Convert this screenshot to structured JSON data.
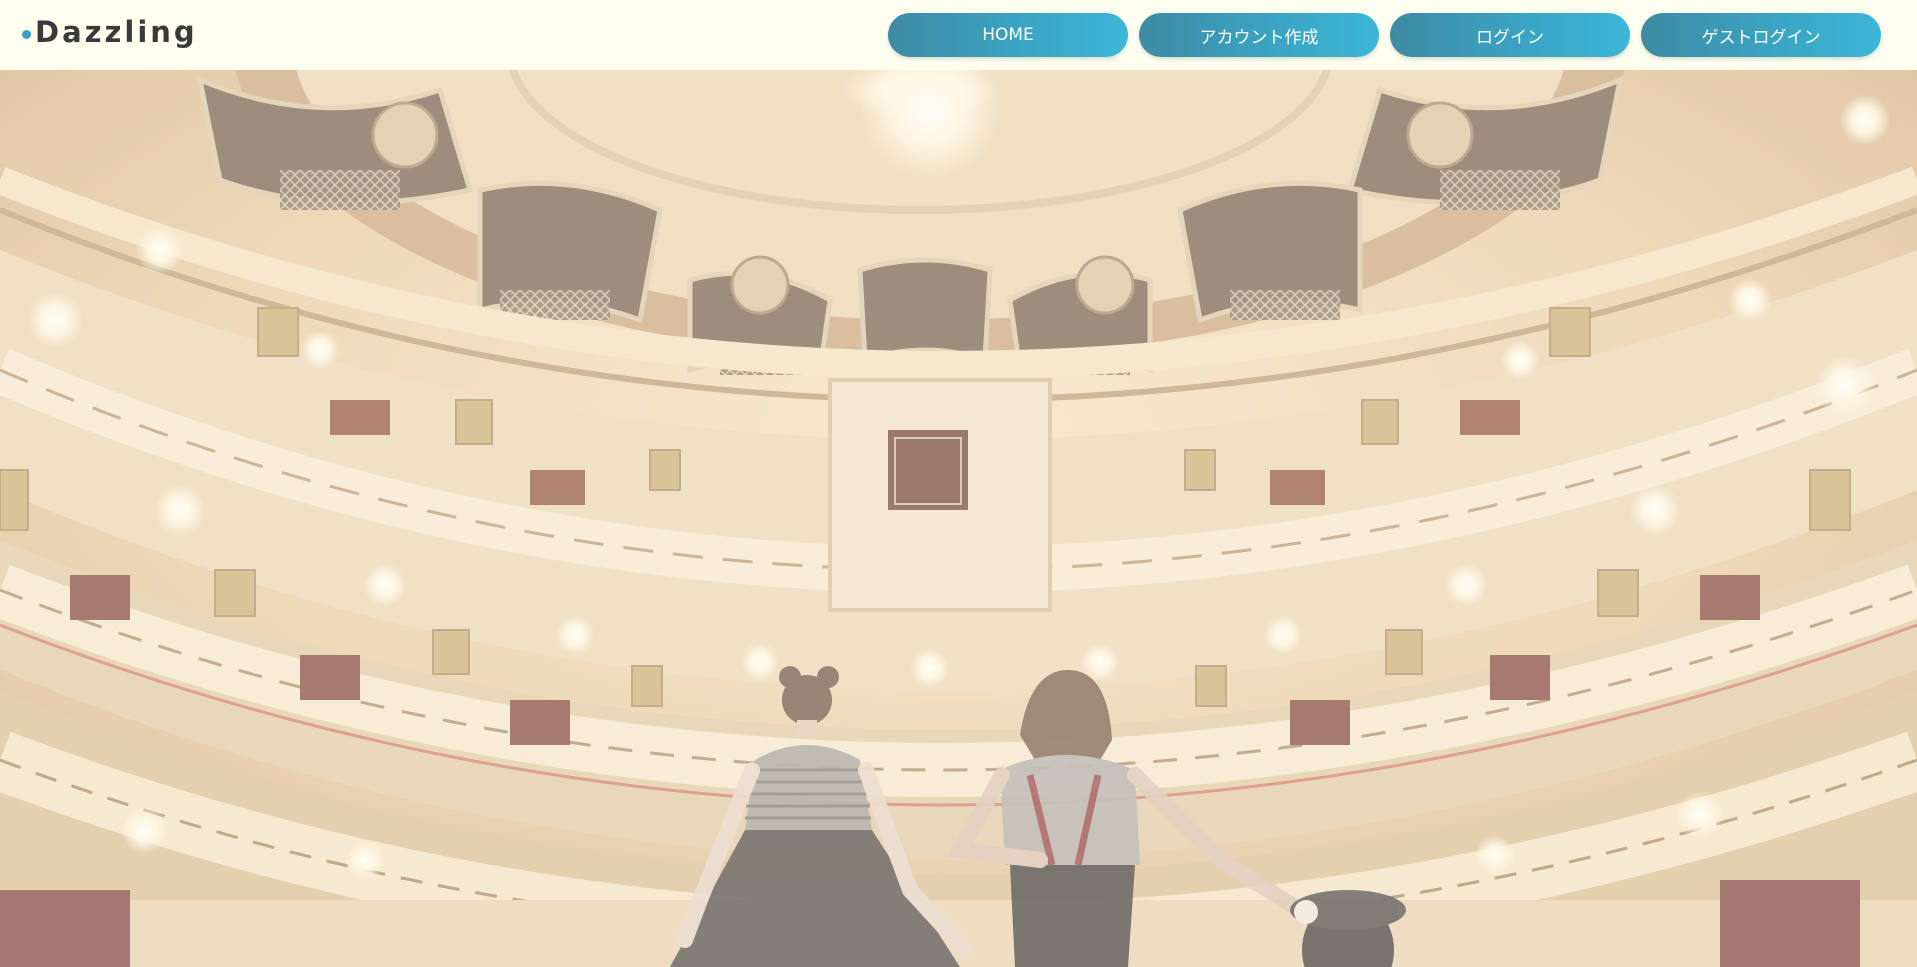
{
  "header": {
    "logo_text": "Dazzling",
    "nav": [
      {
        "label": "HOME"
      },
      {
        "label": "アカウント作成"
      },
      {
        "label": "ログイン"
      },
      {
        "label": "ゲストログイン"
      }
    ]
  },
  "hero": {
    "image": "theater-interior-with-two-performers-photo"
  },
  "colors": {
    "header_bg": "#fffff0",
    "button_start": "#3e8aa3",
    "button_end": "#3cb6d8",
    "logo_dot": "#3a9fc2",
    "logo_text": "#3a3a3a"
  }
}
